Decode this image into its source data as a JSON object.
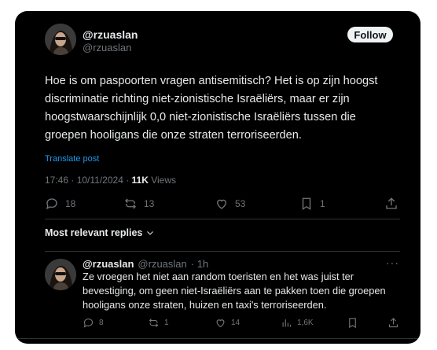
{
  "tweet": {
    "display_name": "@rzuaslan",
    "handle": "@rzuaslan",
    "follow_label": "Follow",
    "text": "Hoe is om paspoorten vragen antisemitisch? Het is op zijn hoogst discriminatie richting niet-zionistische Israëliërs, maar er zijn hoogstwaarschijnlijk 0,0 niet-zionistische Israëliërs tussen die groepen hooligans die onze straten terroriseerden.",
    "translate_label": "Translate post",
    "timestamp": "17:46 · 10/11/2024 · ",
    "views_count": "11K",
    "views_label": " Views",
    "actions": {
      "replies": "18",
      "reposts": "13",
      "likes": "53",
      "bookmarks": "1"
    }
  },
  "replies_section": {
    "label": "Most relevant replies"
  },
  "reply": {
    "display_name": "@rzuaslan",
    "handle": "@rzuaslan",
    "time": "· 1h",
    "more": "···",
    "text": "Ze vroegen het niet aan random toeristen en het was juist ter bevestiging, om geen niet-Israëliërs aan te pakken toen die groepen hooligans onze straten, huizen en taxi's terroriseerden.",
    "actions": {
      "replies": "8",
      "reposts": "1",
      "likes": "14",
      "views": "1,6K"
    }
  },
  "colors": {
    "background": "#000000",
    "text": "#e7e9ea",
    "secondary": "#71767b",
    "link": "#1d9bf0",
    "divider": "#2f3336"
  },
  "icons": [
    "reply-icon",
    "repost-icon",
    "like-icon",
    "bookmark-icon",
    "share-icon",
    "views-icon",
    "chevron-down-icon",
    "more-icon"
  ]
}
